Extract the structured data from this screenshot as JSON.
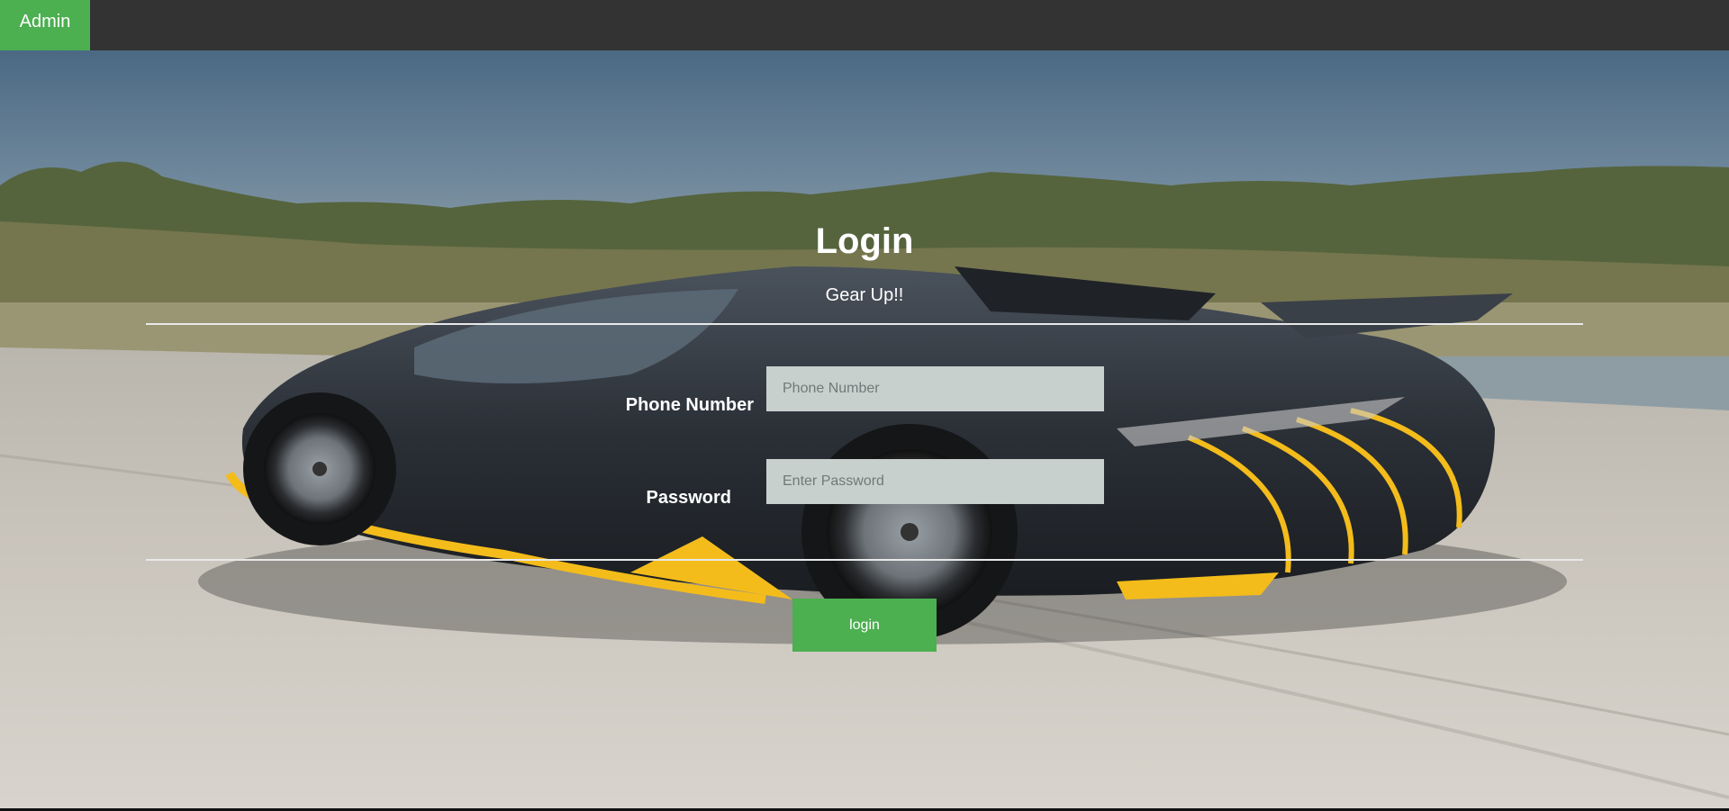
{
  "nav": {
    "admin_label": "Admin"
  },
  "login": {
    "title": "Login",
    "subtitle": "Gear Up!!",
    "phone_label": "Phone Number",
    "phone_placeholder": "Phone Number",
    "phone_value": "",
    "password_label": "Password",
    "password_placeholder": "Enter Password",
    "password_value": "",
    "submit_label": "login"
  },
  "colors": {
    "navbar": "#333333",
    "accent_green": "#4caf50",
    "input_bg": "#c8d0cd"
  },
  "background": {
    "subject": "black and yellow sports car driving on a road"
  }
}
